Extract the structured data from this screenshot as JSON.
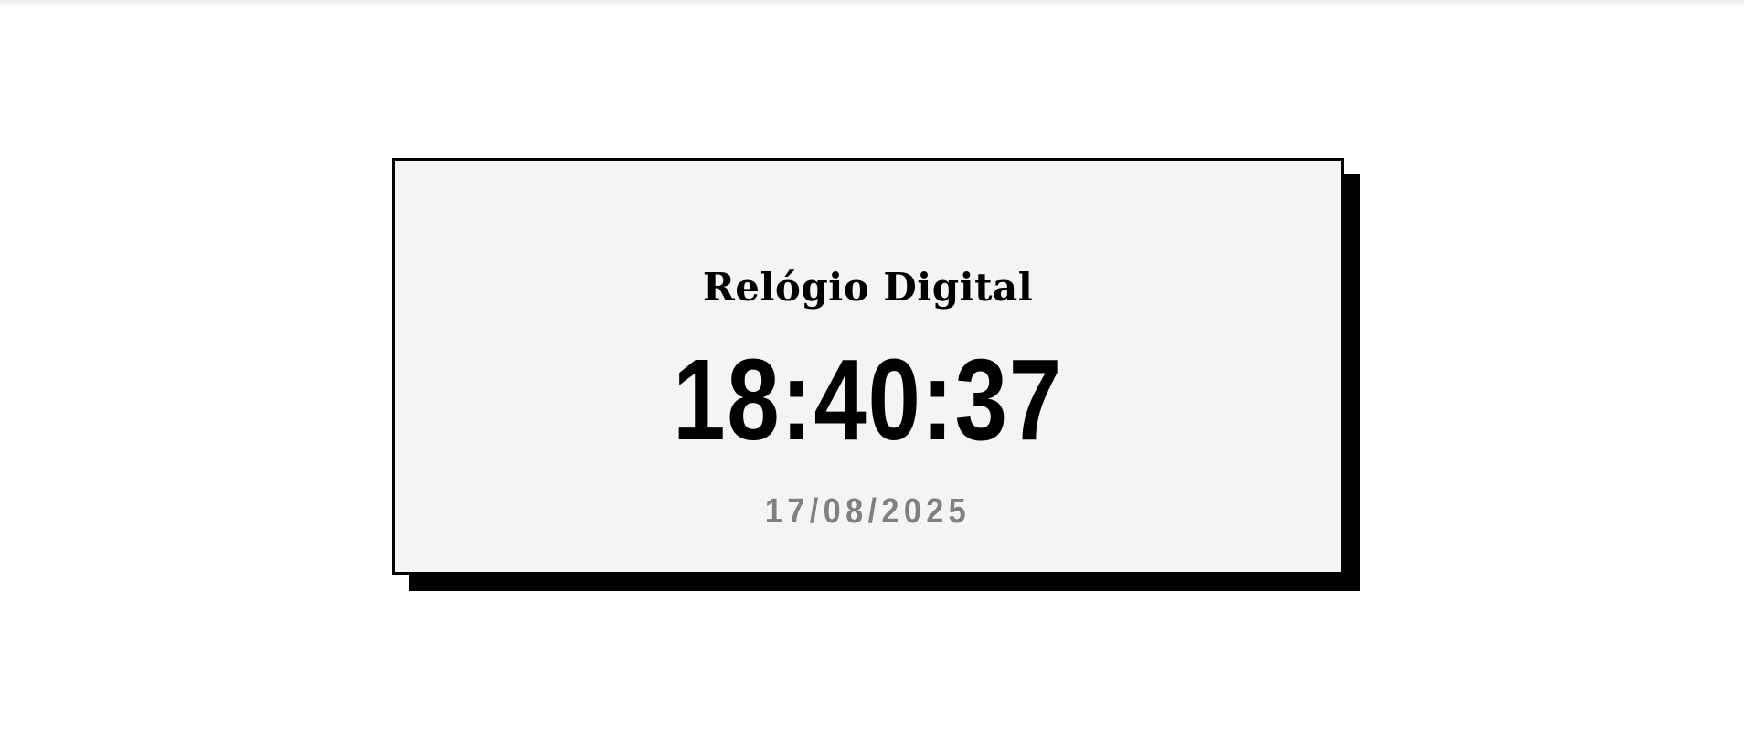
{
  "clock": {
    "title": "Relógio Digital",
    "time": "18:40:37",
    "date": "17/08/2025"
  },
  "colors": {
    "background": "#ffffff",
    "card": "#f4f4f4",
    "border": "#000000",
    "text": "#000000",
    "date": "#808080"
  }
}
